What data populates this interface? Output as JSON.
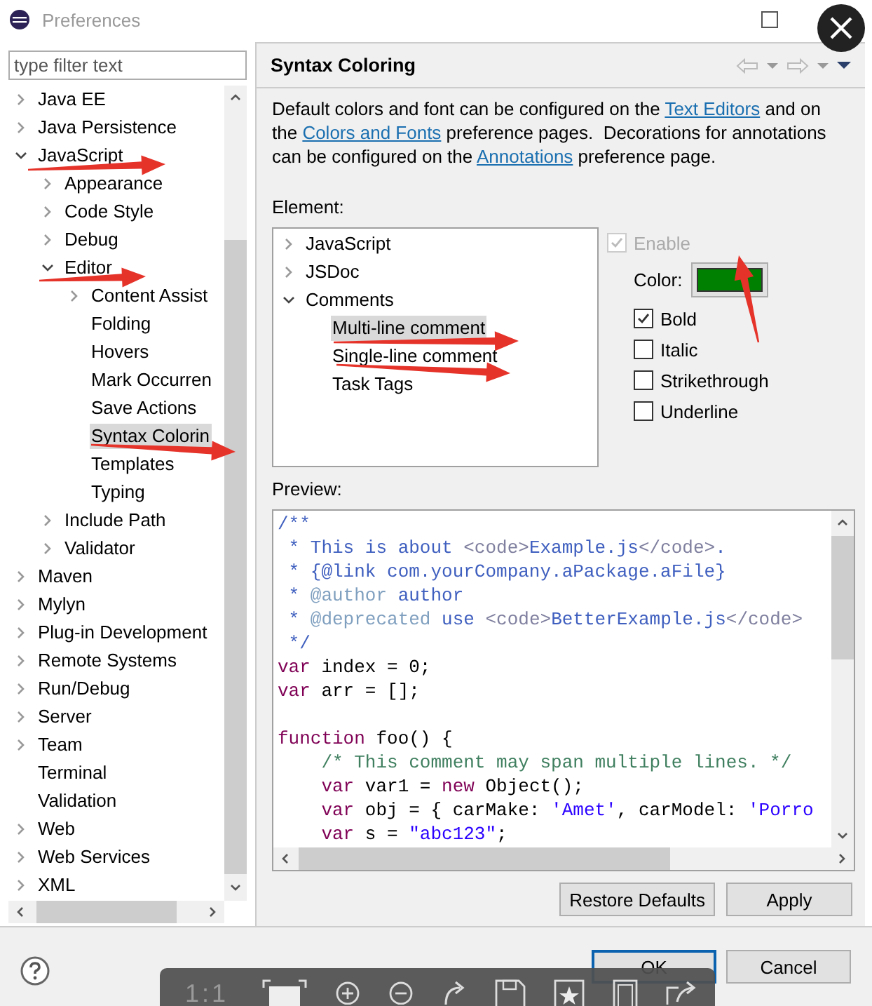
{
  "window": {
    "title": "Preferences"
  },
  "preference_tree": {
    "filter_placeholder": "type filter text",
    "items": [
      {
        "label": "Java EE",
        "expanded": false,
        "selected": false
      },
      {
        "label": "Java Persistence",
        "expanded": false,
        "selected": false
      },
      {
        "label": "JavaScript",
        "expanded": true,
        "selected": false,
        "children": [
          {
            "label": "Appearance",
            "expanded": false,
            "selected": false
          },
          {
            "label": "Code Style",
            "expanded": false,
            "selected": false
          },
          {
            "label": "Debug",
            "expanded": false,
            "selected": false
          },
          {
            "label": "Editor",
            "expanded": true,
            "selected": false,
            "children": [
              {
                "label": "Content Assist",
                "expanded": false,
                "selected": false
              },
              {
                "label": "Folding",
                "selected": false
              },
              {
                "label": "Hovers",
                "selected": false
              },
              {
                "label": "Mark Occurren",
                "selected": false
              },
              {
                "label": "Save Actions",
                "selected": false
              },
              {
                "label": "Syntax Colorin",
                "selected": true
              },
              {
                "label": "Templates",
                "selected": false
              },
              {
                "label": "Typing",
                "selected": false
              }
            ]
          },
          {
            "label": "Include Path",
            "expanded": false,
            "selected": false
          },
          {
            "label": "Validator",
            "expanded": false,
            "selected": false
          }
        ]
      },
      {
        "label": "Maven",
        "expanded": false,
        "selected": false
      },
      {
        "label": "Mylyn",
        "expanded": false,
        "selected": false
      },
      {
        "label": "Plug-in Development",
        "expanded": false,
        "selected": false
      },
      {
        "label": "Remote Systems",
        "expanded": false,
        "selected": false
      },
      {
        "label": "Run/Debug",
        "expanded": false,
        "selected": false
      },
      {
        "label": "Server",
        "expanded": false,
        "selected": false
      },
      {
        "label": "Team",
        "expanded": false,
        "selected": false
      },
      {
        "label": "Terminal",
        "selected": false
      },
      {
        "label": "Validation",
        "selected": false
      },
      {
        "label": "Web",
        "expanded": false,
        "selected": false
      },
      {
        "label": "Web Services",
        "expanded": false,
        "selected": false
      },
      {
        "label": "XML",
        "expanded": false,
        "selected": false
      }
    ]
  },
  "page": {
    "title": "Syntax Coloring",
    "description": [
      {
        "kind": "text",
        "text": "Default colors and font can be configured on the "
      },
      {
        "kind": "link",
        "text": "Text Editors"
      },
      {
        "kind": "text",
        "text": " and on the "
      },
      {
        "kind": "link",
        "text": "Colors and Fonts"
      },
      {
        "kind": "text",
        "text": " preference pages.  Decorations for annotations can be configured on the "
      },
      {
        "kind": "link",
        "text": "Annotations"
      },
      {
        "kind": "text",
        "text": " preference page."
      }
    ],
    "element_label": "Element:",
    "elements": [
      {
        "label": "JavaScript",
        "expanded": false,
        "selected": false
      },
      {
        "label": "JSDoc",
        "expanded": false,
        "selected": false
      },
      {
        "label": "Comments",
        "expanded": true,
        "selected": false,
        "children": [
          {
            "label": "Multi-line comment",
            "selected": true
          },
          {
            "label": "Single-line comment",
            "selected": false
          },
          {
            "label": "Task Tags",
            "selected": false
          }
        ]
      }
    ],
    "options": {
      "enable": {
        "label": "Enable",
        "checked": true,
        "disabled": true
      },
      "color_label": "Color:",
      "color": "#008000",
      "styles": [
        {
          "label": "Bold",
          "checked": true
        },
        {
          "label": "Italic",
          "checked": false
        },
        {
          "label": "Strikethrough",
          "checked": false
        },
        {
          "label": "Underline",
          "checked": false
        }
      ]
    },
    "preview_label": "Preview:",
    "preview_lines": [
      {
        "kind": "code",
        "segments": [
          {
            "kind": "doc",
            "text": "/**"
          }
        ]
      },
      {
        "kind": "code",
        "segments": [
          {
            "kind": "doc",
            "text": " * This is about "
          },
          {
            "kind": "html",
            "text": "<code>"
          },
          {
            "kind": "doc",
            "text": "Example.js"
          },
          {
            "kind": "html",
            "text": "</code>"
          },
          {
            "kind": "doc",
            "text": "."
          }
        ]
      },
      {
        "kind": "code",
        "segments": [
          {
            "kind": "doc",
            "text": " * {@link com.yourCompany.aPackage.aFile}"
          }
        ]
      },
      {
        "kind": "code",
        "segments": [
          {
            "kind": "doc",
            "text": " * "
          },
          {
            "kind": "tag",
            "text": "@author"
          },
          {
            "kind": "doc",
            "text": " author"
          }
        ]
      },
      {
        "kind": "code",
        "segments": [
          {
            "kind": "doc",
            "text": " * "
          },
          {
            "kind": "tag",
            "text": "@deprecated"
          },
          {
            "kind": "doc",
            "text": " use "
          },
          {
            "kind": "html",
            "text": "<code>"
          },
          {
            "kind": "doc",
            "text": "BetterExample.js"
          },
          {
            "kind": "html",
            "text": "</code>"
          }
        ]
      },
      {
        "kind": "code",
        "segments": [
          {
            "kind": "doc",
            "text": " */"
          }
        ]
      },
      {
        "kind": "code",
        "segments": [
          {
            "kind": "keyword",
            "text": "var"
          },
          {
            "kind": "plain",
            "text": " index = 0;"
          }
        ]
      },
      {
        "kind": "code",
        "segments": [
          {
            "kind": "keyword",
            "text": "var"
          },
          {
            "kind": "plain",
            "text": " arr = [];"
          }
        ]
      },
      {
        "kind": "blank"
      },
      {
        "kind": "code",
        "segments": [
          {
            "kind": "keyword",
            "text": "function"
          },
          {
            "kind": "plain",
            "text": " foo() {"
          }
        ]
      },
      {
        "kind": "code",
        "segments": [
          {
            "kind": "comment",
            "text": "    /* This comment may span multiple lines. */"
          }
        ]
      },
      {
        "kind": "code",
        "segments": [
          {
            "kind": "keyword",
            "text": "    var"
          },
          {
            "kind": "plain",
            "text": " var1 = "
          },
          {
            "kind": "keyword",
            "text": "new"
          },
          {
            "kind": "plain",
            "text": " Object();"
          }
        ]
      },
      {
        "kind": "code",
        "segments": [
          {
            "kind": "keyword",
            "text": "    var"
          },
          {
            "kind": "plain",
            "text": " obj = { carMake: "
          },
          {
            "kind": "string",
            "text": "'Amet'"
          },
          {
            "kind": "plain",
            "text": ", carModel: "
          },
          {
            "kind": "string",
            "text": "'Porro"
          }
        ]
      },
      {
        "kind": "code",
        "segments": [
          {
            "kind": "keyword",
            "text": "    var"
          },
          {
            "kind": "plain",
            "text": " s = "
          },
          {
            "kind": "string",
            "text": "\"abc123\""
          },
          {
            "kind": "plain",
            "text": ";"
          }
        ]
      }
    ],
    "buttons": [
      "Restore Defaults",
      "Apply"
    ]
  },
  "footer_buttons": [
    {
      "label": "OK",
      "default": true
    },
    {
      "label": "Cancel",
      "default": false
    }
  ],
  "viewer_toolbar": {
    "zoom_label": "1:1"
  }
}
